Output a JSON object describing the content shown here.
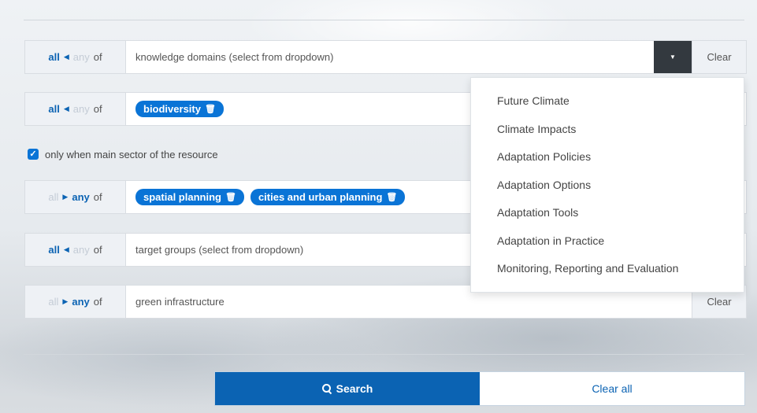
{
  "toggle": {
    "all": "all",
    "any": "any",
    "of": "of"
  },
  "filters": {
    "knowledge_domains": {
      "placeholder": "knowledge domains (select from dropdown)",
      "clear": "Clear"
    },
    "sectors": {
      "tag": "biodiversity"
    },
    "main_sector_checkbox": {
      "label": "only when main sector of the resource",
      "checked": true
    },
    "elements": {
      "tags": [
        "spatial planning",
        "cities and urban planning"
      ]
    },
    "target_groups": {
      "placeholder": "target groups (select from dropdown)"
    },
    "keywords": {
      "value": "green infrastructure",
      "clear": "Clear"
    }
  },
  "dropdown_menu": {
    "items": [
      "Future Climate",
      "Climate Impacts",
      "Adaptation Policies",
      "Adaptation Options",
      "Adaptation Tools",
      "Adaptation in Practice",
      "Monitoring, Reporting and Evaluation"
    ]
  },
  "actions": {
    "search": "Search",
    "clear_all": "Clear all"
  },
  "colors": {
    "accent": "#0b63b3",
    "tag": "#0a74d6",
    "dropdown_button": "#33393f"
  },
  "icons": {
    "trash": "trash-icon",
    "search": "search-icon",
    "caret": "caret-down-icon",
    "check": "check-icon"
  }
}
